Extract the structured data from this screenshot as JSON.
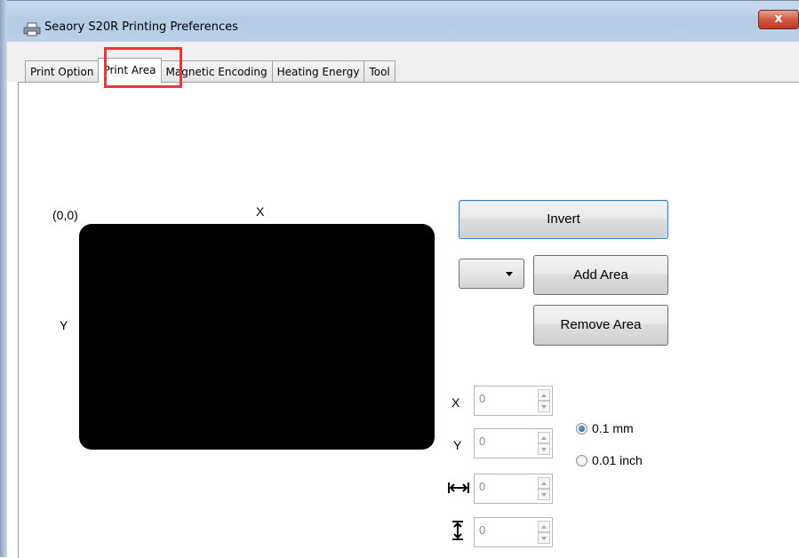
{
  "window": {
    "title": "Seaory S20R Printing Preferences",
    "close_label": "x"
  },
  "tabs": [
    {
      "label": "Print Option",
      "active": false
    },
    {
      "label": "Print Area",
      "active": true
    },
    {
      "label": "Magnetic Encoding",
      "active": false
    },
    {
      "label": "Heating Energy",
      "active": false
    },
    {
      "label": "Tool",
      "active": false
    }
  ],
  "canvas": {
    "origin_label": "(0,0)",
    "x_axis_label": "X",
    "y_axis_label": "Y",
    "card_color": "#000000"
  },
  "buttons": {
    "invert": "Invert",
    "add_area": "Add Area",
    "remove_area": "Remove Area"
  },
  "area_select": {
    "selected": ""
  },
  "fields": {
    "x": {
      "label": "X",
      "value": "0"
    },
    "y": {
      "label": "Y",
      "value": "0"
    },
    "width": {
      "icon": "width-arrows-icon",
      "value": "0"
    },
    "height": {
      "icon": "height-arrows-icon",
      "value": "0"
    }
  },
  "units": {
    "mm": {
      "label": "0.1 mm",
      "checked": true
    },
    "inch": {
      "label": "0.01 inch",
      "checked": false
    }
  },
  "colors": {
    "highlight": "#e5383b",
    "titlebar": "#bcd1ea"
  }
}
